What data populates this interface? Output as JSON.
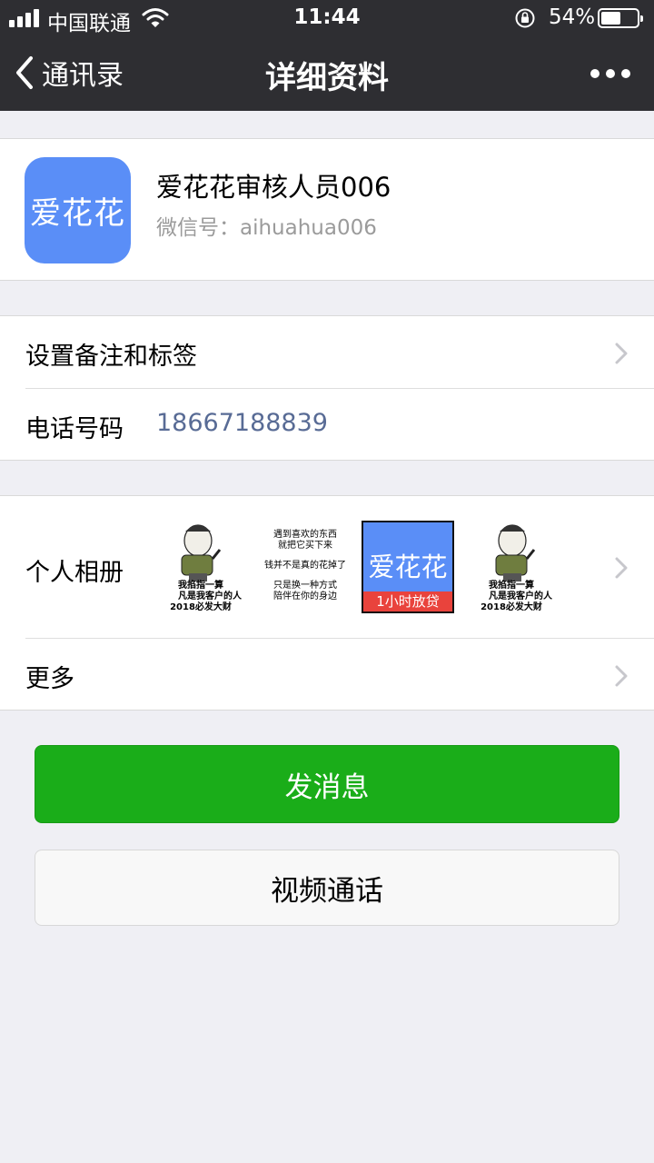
{
  "status_bar": {
    "carrier": "中国联通",
    "time": "11:44",
    "battery_percent": "54%",
    "battery_level": 0.54,
    "icons": [
      "signal-icon",
      "wifi-icon",
      "orientation-lock-icon",
      "battery-icon"
    ]
  },
  "nav": {
    "back_label": "通讯录",
    "title": "详细资料",
    "back_icon": "chevron-left-icon",
    "more_icon": "more-dots-icon"
  },
  "profile": {
    "avatar_text": "爱花花",
    "name": "爱花花审核人员006",
    "wechat_id": "微信号：aihuahua006"
  },
  "details": {
    "remark_label": "设置备注和标签",
    "phone_label": "电话号码",
    "phone_value": "18667188839"
  },
  "album": {
    "label": "个人相册",
    "thumbs": [
      {
        "type": "meme",
        "caption": [
          "我掐指一算",
          "凡是我客户的人",
          "2018必发大财"
        ]
      },
      {
        "type": "text",
        "lines": [
          "遇到喜欢的东西",
          "就把它买下来",
          "钱并不是真的花掉了",
          "只是换一种方式",
          "陪伴在你的身边"
        ]
      },
      {
        "type": "brand",
        "title": "爱花花",
        "badge": "1小时放贷"
      },
      {
        "type": "meme",
        "caption": [
          "我掐指一算",
          "凡是我客户的人",
          "2018必发大财"
        ]
      }
    ]
  },
  "more": {
    "label": "更多"
  },
  "actions": {
    "send_message": "发消息",
    "video_call": "视频通话"
  },
  "colors": {
    "navbar": "#2e2e32",
    "background": "#efeff4",
    "primary_green": "#1aad19",
    "link_blue": "#586b95",
    "brand_blue": "#5a8ef7"
  }
}
